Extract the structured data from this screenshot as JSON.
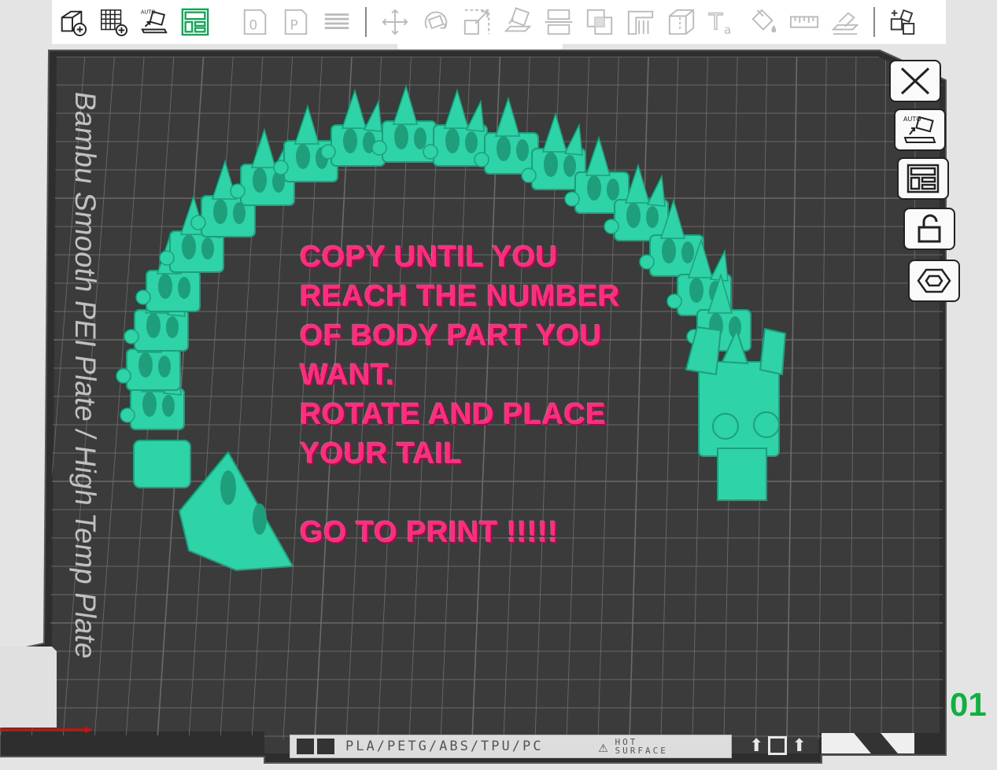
{
  "toolbar": {
    "tools": [
      {
        "icon": "add-cube-icon"
      },
      {
        "icon": "add-plate-icon"
      },
      {
        "icon": "auto-orient-icon",
        "label": "AUTO"
      },
      {
        "icon": "arrange-icon",
        "active": true
      },
      {
        "icon": "slice-plate-0-icon",
        "label": "0"
      },
      {
        "icon": "slice-plate-p-icon",
        "label": "P"
      },
      {
        "icon": "layers-icon"
      },
      {
        "icon": "move-icon"
      },
      {
        "icon": "rotate-icon"
      },
      {
        "icon": "scale-icon"
      },
      {
        "icon": "lay-on-face-icon"
      },
      {
        "icon": "cut-icon"
      },
      {
        "icon": "boolean-icon"
      },
      {
        "icon": "support-paint-icon"
      },
      {
        "icon": "seam-paint-icon"
      },
      {
        "icon": "text-tool-icon",
        "label": "Ta"
      },
      {
        "icon": "color-paint-icon"
      },
      {
        "icon": "measure-icon"
      },
      {
        "icon": "assembly-icon"
      },
      {
        "icon": "variable-layer-icon"
      }
    ]
  },
  "right_tools": [
    {
      "icon": "close-icon"
    },
    {
      "icon": "auto-orient-icon",
      "label": "AUTO"
    },
    {
      "icon": "arrange-icon"
    },
    {
      "icon": "lock-icon"
    },
    {
      "icon": "plate-settings-icon"
    }
  ],
  "plate": {
    "name": "Bambu Smooth PEI Plate / High Temp Plate",
    "number": "01",
    "filaments": "PLA/PETG/ABS/TPU/PC",
    "hot_surface_1": "HOT",
    "hot_surface_2": "SURFACE"
  },
  "note": {
    "lines": [
      "COPY UNTIL YOU",
      "REACH THE NUMBER",
      "OF BODY PART YOU",
      "WANT.",
      "ROTATE AND PLACE",
      "YOUR TAIL",
      "",
      "GO TO PRINT !!!!!"
    ]
  },
  "colors": {
    "plate_bg": "#3b3b3b",
    "grid": "#6a6a6a",
    "model": "#2ed3a7",
    "note": "#ff2d7e",
    "plate_number": "#10b040"
  }
}
